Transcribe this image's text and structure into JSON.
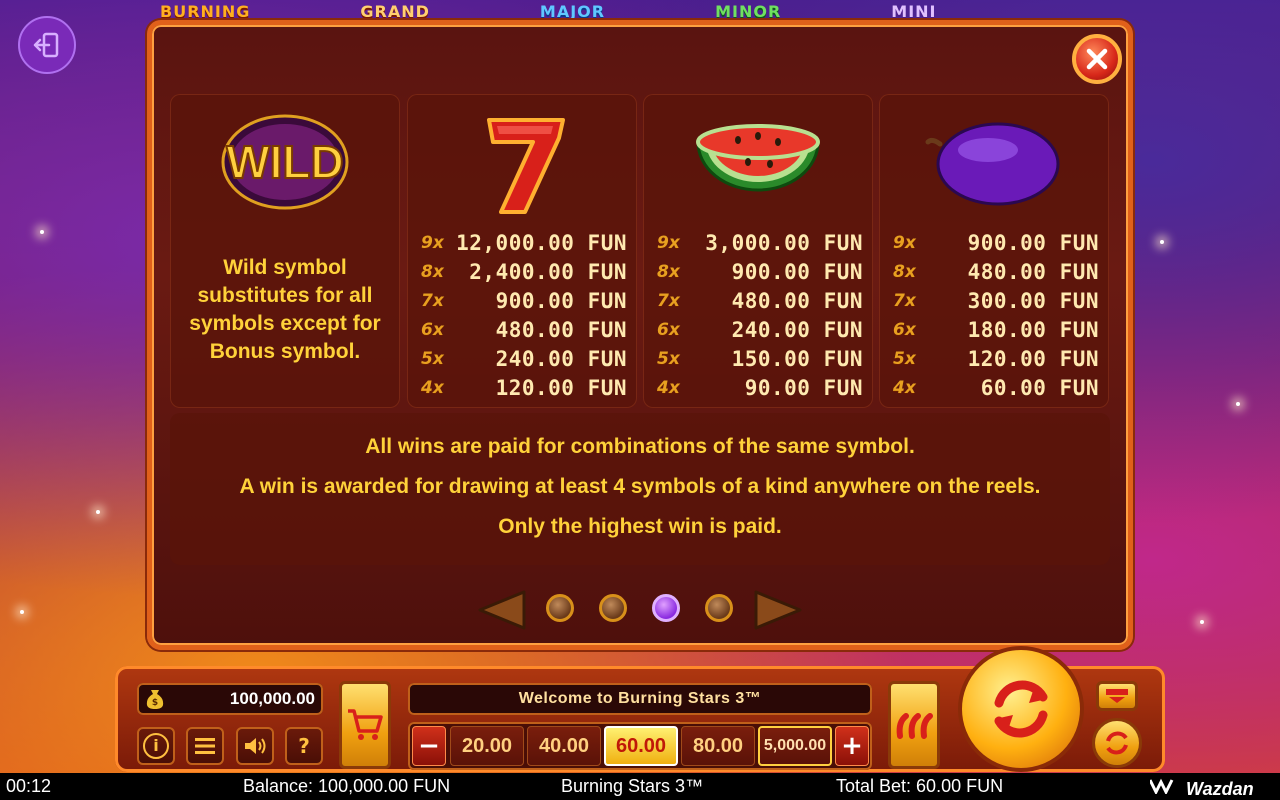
{
  "jackpots": [
    "BURNING",
    "GRAND",
    "MAJOR",
    "MINOR",
    "MINI"
  ],
  "symbols": [
    {
      "name": "wild",
      "description": "Wild symbol substitutes for all symbols except for Bonus symbol."
    },
    {
      "name": "seven",
      "pays": [
        [
          "9x",
          "12,000.00 FUN"
        ],
        [
          "8x",
          "2,400.00 FUN"
        ],
        [
          "7x",
          "900.00 FUN"
        ],
        [
          "6x",
          "480.00 FUN"
        ],
        [
          "5x",
          "240.00 FUN"
        ],
        [
          "4x",
          "120.00 FUN"
        ]
      ]
    },
    {
      "name": "watermelon",
      "pays": [
        [
          "9x",
          "3,000.00 FUN"
        ],
        [
          "8x",
          "900.00 FUN"
        ],
        [
          "7x",
          "480.00 FUN"
        ],
        [
          "6x",
          "240.00 FUN"
        ],
        [
          "5x",
          "150.00 FUN"
        ],
        [
          "4x",
          "90.00 FUN"
        ]
      ]
    },
    {
      "name": "plum",
      "pays": [
        [
          "9x",
          "900.00 FUN"
        ],
        [
          "8x",
          "480.00 FUN"
        ],
        [
          "7x",
          "300.00 FUN"
        ],
        [
          "6x",
          "180.00 FUN"
        ],
        [
          "5x",
          "120.00 FUN"
        ],
        [
          "4x",
          "60.00 FUN"
        ]
      ]
    }
  ],
  "wild_label": "WILD",
  "info": {
    "line1": "All wins are paid for combinations of the same symbol.",
    "line2": "A win is awarded for drawing at least 4 symbols of a kind anywhere on the reels.",
    "line3": "Only the highest win is paid."
  },
  "pager": {
    "pages": 4,
    "current": 3
  },
  "controls": {
    "balance": "100,000.00",
    "message": "Welcome to Burning Stars 3™",
    "bets": [
      "20.00",
      "40.00",
      "60.00",
      "80.00",
      "5,000.00"
    ],
    "selected_bet": "60.00",
    "info_btn": "i",
    "help_btn": "?"
  },
  "status": {
    "time": "00:12",
    "balance": "Balance: 100,000.00 FUN",
    "game": "Burning Stars 3™",
    "total_bet": "Total Bet: 60.00 FUN",
    "brand": "Wazdan"
  },
  "colors": {
    "accent": "#ffd23a",
    "panel": "#5a1410",
    "border": "#e0601a",
    "active_dot": "#8a2ae0"
  }
}
